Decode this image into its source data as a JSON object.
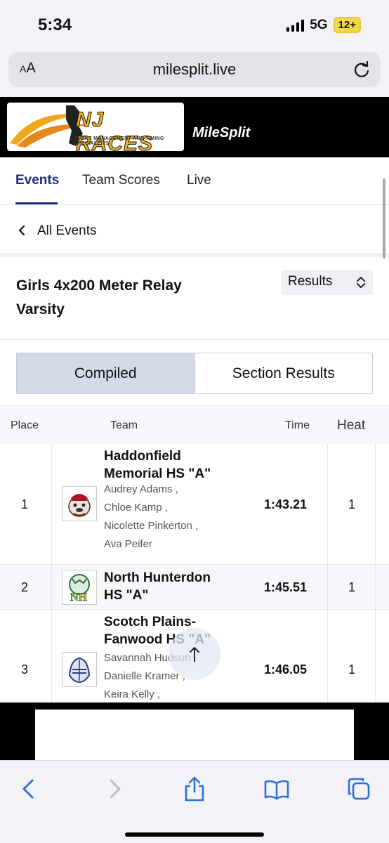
{
  "status": {
    "time": "5:34",
    "network": "5G",
    "battery": "12+"
  },
  "browser": {
    "aa_small": "A",
    "aa_large": "A",
    "url": "milesplit.live"
  },
  "banner": {
    "logo_title": "NJ RACES",
    "logo_subtitle": "EVENT MANAGEMENT AND TIMING SPECIALISTS",
    "milesplit": "MileSplit"
  },
  "tabs": [
    {
      "label": "Events"
    },
    {
      "label": "Team Scores"
    },
    {
      "label": "Live"
    }
  ],
  "back": {
    "label": "All Events"
  },
  "event": {
    "title_line1": "Girls 4x200 Meter Relay",
    "title_line2": "Varsity",
    "view_select": "Results"
  },
  "toggle": {
    "compiled": "Compiled",
    "section": "Section Results"
  },
  "table": {
    "headers": {
      "place": "Place",
      "team": "Team",
      "time": "Time",
      "heat": "Heat"
    },
    "rows": [
      {
        "place": "1",
        "team_line1": "Haddonfield",
        "team_line2": "Memorial HS \"A\"",
        "athletes": [
          "Audrey Adams ,",
          "Chloe Kamp ,",
          "Nicolette Pinkerton ,",
          "Ava Peifer"
        ],
        "time": "1:43.21",
        "heat": "1"
      },
      {
        "place": "2",
        "team_line1": "North Hunterdon",
        "team_line2": "HS \"A\"",
        "athletes": [],
        "time": "1:45.51",
        "heat": "1"
      },
      {
        "place": "3",
        "team_line1": "Scotch Plains-",
        "team_line2": "Fanwood HS \"A\"",
        "athletes": [
          "Savannah Hudson ,",
          "Danielle Kramer ,",
          "Keira Kelly ,"
        ],
        "time": "1:46.05",
        "heat": "1"
      }
    ]
  },
  "icons": {
    "reload": "reload-icon",
    "back": "chevron-left-icon",
    "sort": "sort-updown-icon",
    "scroll_top": "arrow-up-icon"
  },
  "colors": {
    "accent": "#1c2a80",
    "toggle_active": "#d3dbea"
  }
}
